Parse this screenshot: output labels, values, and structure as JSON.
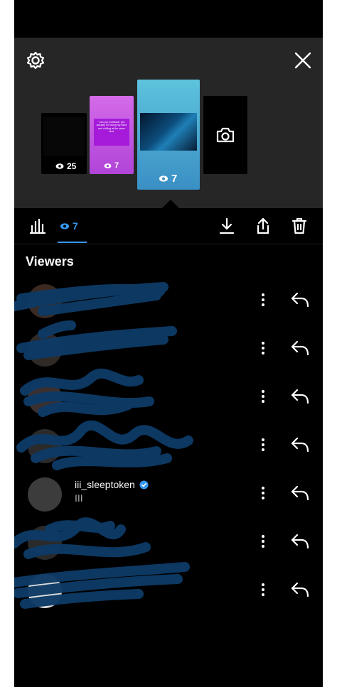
{
  "story_header": {
    "settings_icon": "gear-icon",
    "close_icon": "close-icon",
    "camera_icon": "camera-icon",
    "stories": [
      {
        "views": "25"
      },
      {
        "views": "7",
        "quote": "\"can you multitask\" yes actually i'm losing my mind and chilling at the same time"
      },
      {
        "views": "7"
      }
    ]
  },
  "tabs": {
    "insights_icon": "bar-chart-icon",
    "viewers_count": "7",
    "download_icon": "download-icon",
    "share_icon": "share-icon",
    "delete_icon": "trash-icon"
  },
  "viewers_title": "Viewers",
  "viewers": [
    {
      "username": "",
      "subtitle": ""
    },
    {
      "username": "",
      "subtitle": ""
    },
    {
      "username": "",
      "subtitle": ""
    },
    {
      "username": "",
      "subtitle": ""
    },
    {
      "username": "iii_sleeptoken",
      "subtitle": "III",
      "verified": true
    },
    {
      "username": "",
      "subtitle": ""
    },
    {
      "username": "",
      "subtitle": ""
    }
  ],
  "colors": {
    "accent": "#3797f0",
    "header_bg": "#262626",
    "scribble": "#0d3a66"
  }
}
